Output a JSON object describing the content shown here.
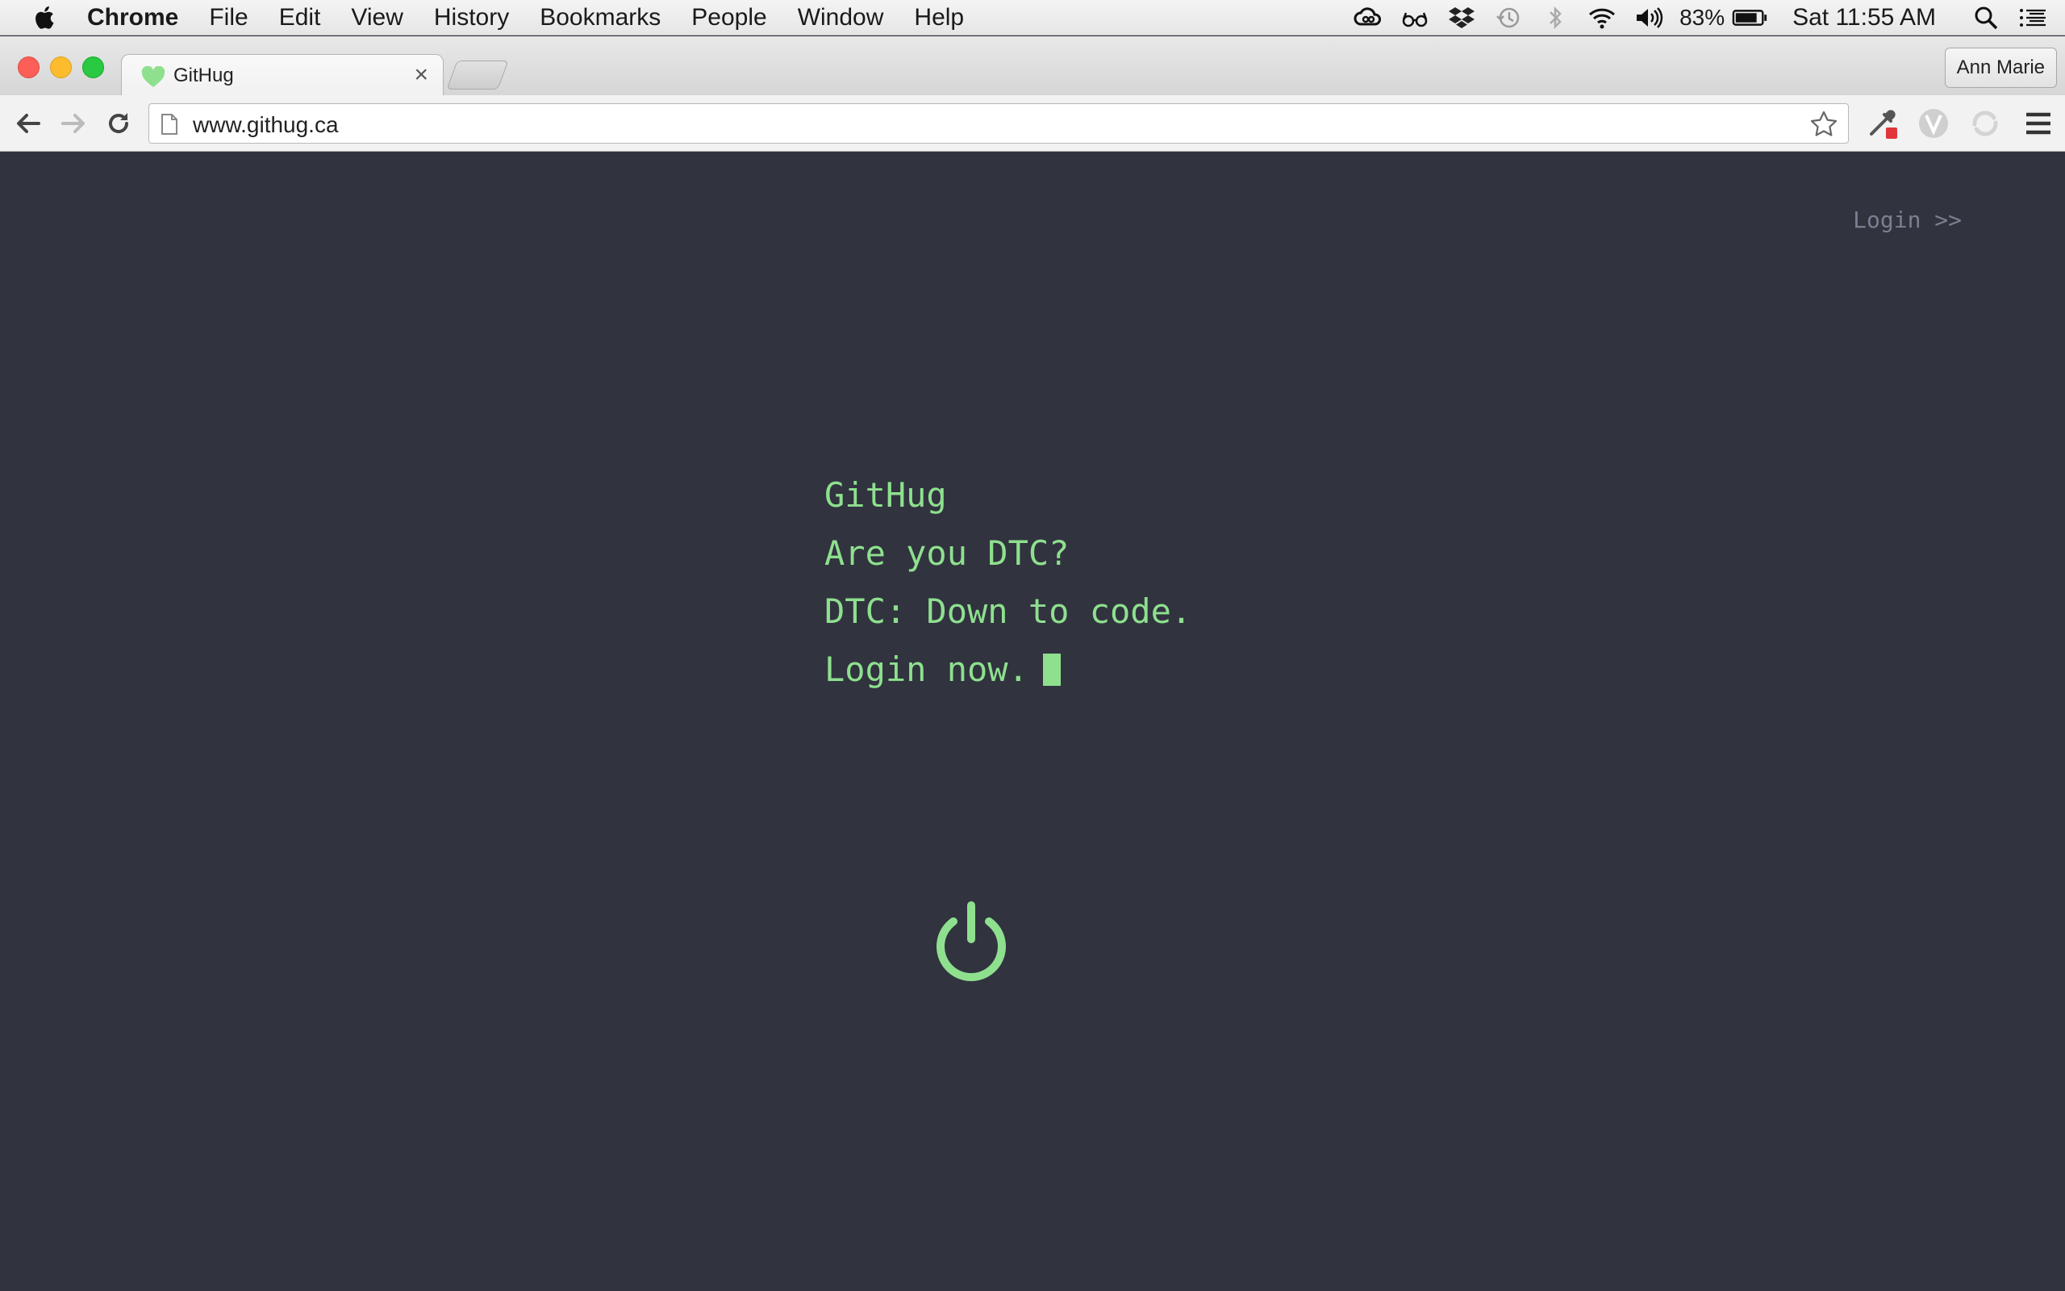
{
  "menubar": {
    "app_name": "Chrome",
    "items": [
      "File",
      "Edit",
      "View",
      "History",
      "Bookmarks",
      "People",
      "Window",
      "Help"
    ],
    "battery_percent": "83%",
    "clock": "Sat 11:55 AM"
  },
  "browser": {
    "tab_title": "GitHug",
    "tab_close": "×",
    "profile_name": "Ann Marie",
    "url": "www.githug.ca"
  },
  "page": {
    "login_link": "Login >>",
    "lines": [
      "GitHug",
      "Are you DTC?",
      "DTC: Down to code.",
      "Login now."
    ]
  },
  "colors": {
    "background": "#31333f",
    "accent_green": "#8ee08e",
    "muted_link": "#7b7f8e"
  },
  "icons": [
    "apple-icon",
    "creative-cloud-icon",
    "glasses-icon",
    "dropbox-icon",
    "time-machine-icon",
    "bluetooth-icon",
    "wifi-icon",
    "volume-icon",
    "battery-icon",
    "spotlight-icon",
    "notification-center-icon",
    "heart-favicon",
    "back-icon",
    "forward-icon",
    "reload-icon",
    "page-icon",
    "bookmark-star-icon",
    "eyedropper-extension-icon",
    "v-extension-icon",
    "swirl-extension-icon",
    "chrome-menu-icon",
    "power-icon"
  ]
}
